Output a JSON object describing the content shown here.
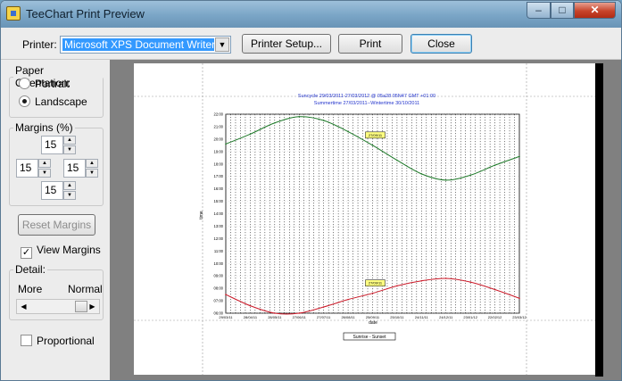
{
  "window": {
    "title": "TeeChart Print Preview",
    "minimize_glyph": "–",
    "maximize_glyph": "□",
    "close_glyph": "✕"
  },
  "toolbar": {
    "printer_label": "Printer:",
    "printer_value": "Microsoft XPS Document Writer",
    "printer_setup_label": "Printer Setup...",
    "print_label": "Print",
    "close_label": "Close"
  },
  "orientation": {
    "legend": "Paper Orientation:",
    "options": [
      {
        "label": "Portrait",
        "selected": false
      },
      {
        "label": "Landscape",
        "selected": true
      }
    ]
  },
  "margins": {
    "legend": "Margins (%)",
    "top": "15",
    "left": "15",
    "right": "15",
    "bottom": "15"
  },
  "reset_margins_label": "Reset Margins",
  "view_margins": {
    "label": "View Margins",
    "checked": true
  },
  "detail": {
    "legend": "Detail:",
    "more_label": "More",
    "normal_label": "Normal",
    "level": 0.8
  },
  "proportional": {
    "label": "Proportional",
    "checked": false
  },
  "chart_data": {
    "type": "line",
    "title": "Suncycle 29/03/2011-27/03/2012 @ 05a28 05N47  GMT +01:00",
    "subtitle": "Summertime 27/03/2011--Wintertime 30/10/2011",
    "xlabel": "date",
    "ylabel": "time",
    "y_ticks": [
      "22:00",
      "21:00",
      "20:00",
      "19:00",
      "18:00",
      "17:00",
      "16:00",
      "15:00",
      "14:00",
      "13:00",
      "12:00",
      "11:00",
      "10:00",
      "09:00",
      "08:00",
      "07:00",
      "06:00"
    ],
    "x_ticks": [
      "29/03/11",
      "28/04/11",
      "28/05/11",
      "27/06/11",
      "27/07/11",
      "26/08/11",
      "25/09/11",
      "25/10/11",
      "24/11/11",
      "24/12/11",
      "23/01/12",
      "22/02/12",
      "23/03/12"
    ],
    "ylim": [
      6,
      22
    ],
    "legend_label": "Sunrise - Sunset",
    "annotations": [
      "27/09/11",
      "27/09/11"
    ],
    "series": [
      {
        "name": "Sunset",
        "color": "#1f7a2a",
        "values": [
          19.6,
          20.4,
          21.3,
          21.8,
          21.5,
          20.6,
          19.5,
          18.3,
          17.2,
          16.7,
          17.1,
          17.9,
          18.6
        ]
      },
      {
        "name": "Sunrise",
        "color": "#cc1b2a",
        "values": [
          7.5,
          6.6,
          6.0,
          6.0,
          6.5,
          7.1,
          7.6,
          8.2,
          8.6,
          8.8,
          8.5,
          7.9,
          7.2
        ]
      }
    ]
  }
}
